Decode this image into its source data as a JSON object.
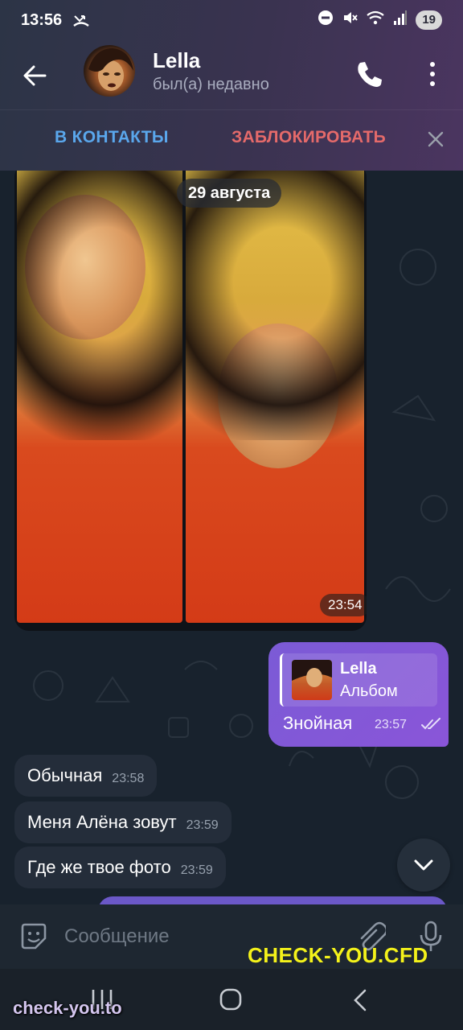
{
  "status_bar": {
    "time": "13:56",
    "battery": "19"
  },
  "header": {
    "contact_name": "Lella",
    "contact_status": "был(а) недавно"
  },
  "action_bar": {
    "add_contact": "В КОНТАКТЫ",
    "block": "ЗАБЛОКИРОВАТЬ"
  },
  "chat": {
    "date_separator": "29 августа",
    "album_time": "23:54",
    "outgoing": {
      "reply_name": "Lella",
      "reply_text": "Альбом",
      "text": "Знойная",
      "time": "23:57"
    },
    "incoming": [
      {
        "text": "Обычная",
        "time": "23:58"
      },
      {
        "text": "Меня Алёна зовут",
        "time": "23:59"
      },
      {
        "text": "Где же твое фото",
        "time": "23:59"
      }
    ]
  },
  "composer": {
    "placeholder": "Сообщение"
  },
  "watermarks": {
    "site_cfd": "CHECK-YOU.CFD",
    "site_to": "check-you.to"
  },
  "colors": {
    "accent_blue": "#5aa7ec",
    "accent_red": "#e56a6a",
    "outgoing_bubble": "#7b5bd6",
    "incoming_bubble": "#242d3a",
    "watermark_yellow": "#f4f21a"
  }
}
